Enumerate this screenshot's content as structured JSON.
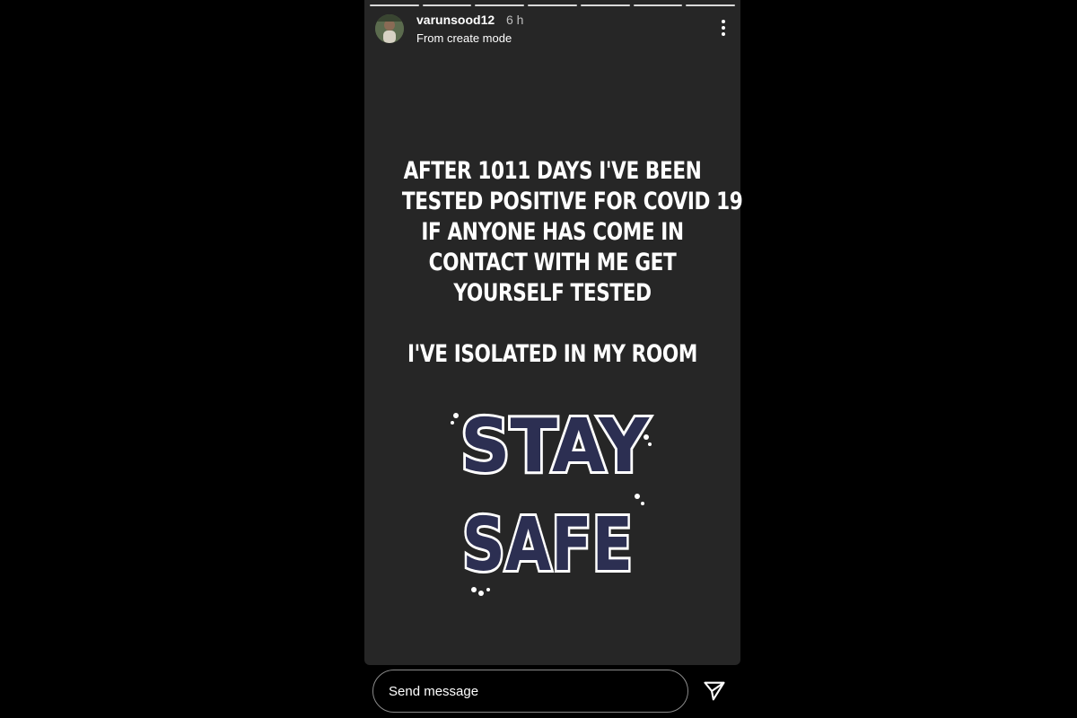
{
  "story": {
    "username": "varunsood12",
    "time_ago": "6 h",
    "subline": "From create mode",
    "progress_segments": 7,
    "text_lines": [
      "AFTER 1011 DAYS I'VE BEEN",
      "TESTED POSITIVE FOR COVID 19",
      "IF ANYONE HAS COME IN",
      "CONTACT WITH ME GET",
      "YOURSELF TESTED"
    ],
    "isolation_line": "I'VE ISOLATED IN MY ROOM",
    "sticker": {
      "word1": "STAY",
      "word2": "SAFE"
    }
  },
  "message_bar": {
    "placeholder": "Send message"
  },
  "icons": {
    "more": "kebab-icon",
    "send": "paper-plane-icon"
  },
  "colors": {
    "background": "#000000",
    "story": "#262626",
    "sticker_fill": "#2c2f52"
  }
}
